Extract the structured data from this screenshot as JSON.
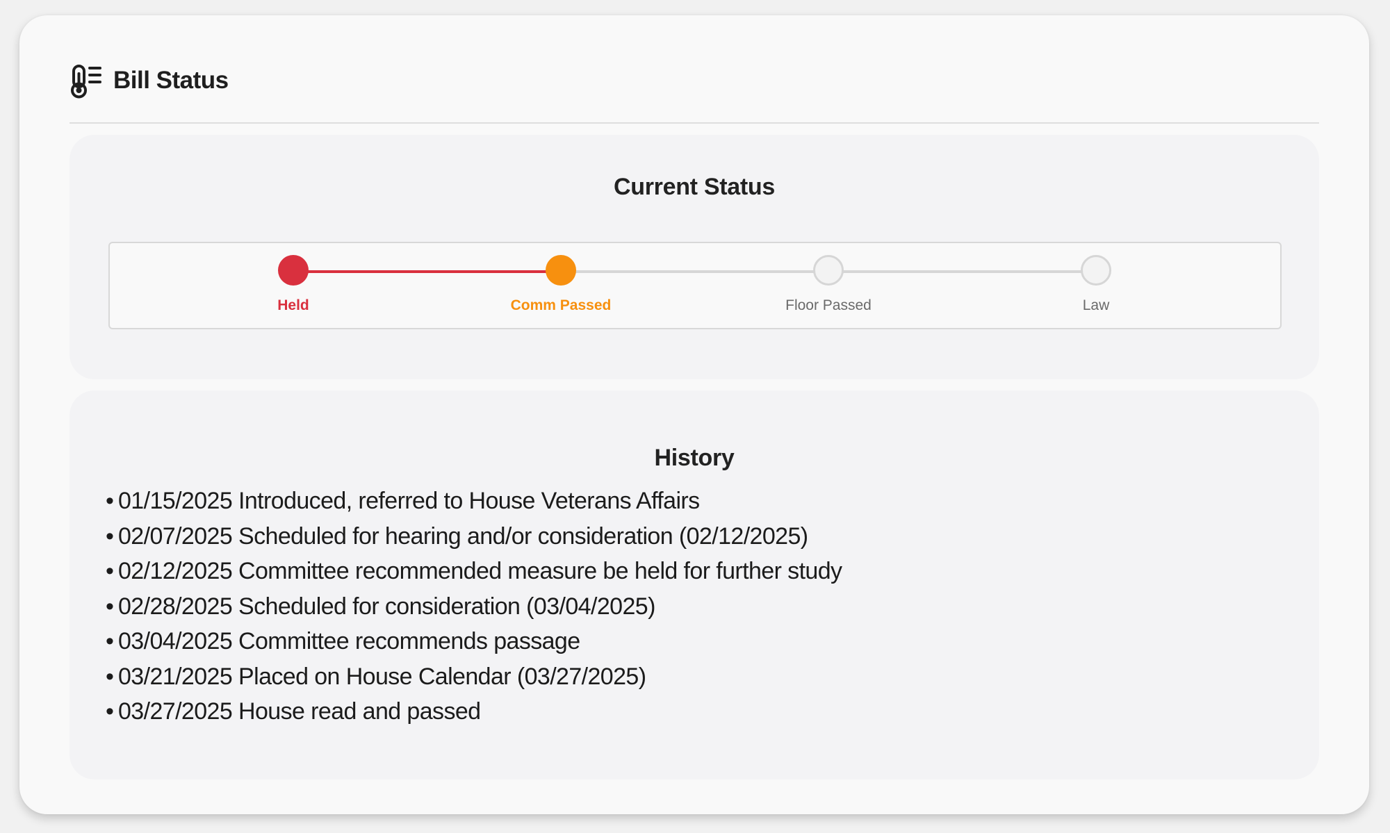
{
  "header": {
    "icon": "thermometer-list-icon",
    "title": "Bill Status"
  },
  "status": {
    "title": "Current Status",
    "current_index": 1,
    "steps": [
      {
        "label": "Held",
        "state": "complete",
        "color": "#d9303e"
      },
      {
        "label": "Comm Passed",
        "state": "current",
        "color": "#f7900f"
      },
      {
        "label": "Floor Passed",
        "state": "pending",
        "color": "#6a6a6a"
      },
      {
        "label": "Law",
        "state": "pending",
        "color": "#6a6a6a"
      }
    ]
  },
  "history": {
    "title": "History",
    "bullet": "•",
    "items": [
      {
        "date": "01/15/2025",
        "text": "Introduced, referred to House Veterans Affairs"
      },
      {
        "date": "02/07/2025",
        "text": "Scheduled for hearing and/or consideration (02/12/2025)"
      },
      {
        "date": "02/12/2025",
        "text": "Committee recommended measure be held for further study"
      },
      {
        "date": "02/28/2025",
        "text": "Scheduled for consideration (03/04/2025)"
      },
      {
        "date": "03/04/2025",
        "text": "Committee recommends passage"
      },
      {
        "date": "03/21/2025",
        "text": "Placed on House Calendar (03/27/2025)"
      },
      {
        "date": "03/27/2025",
        "text": "House read and passed"
      }
    ]
  },
  "colors": {
    "held": "#d9303e",
    "comm_passed": "#f7900f",
    "pending_ring": "#d6d6d6",
    "pending_text": "#6a6a6a"
  }
}
